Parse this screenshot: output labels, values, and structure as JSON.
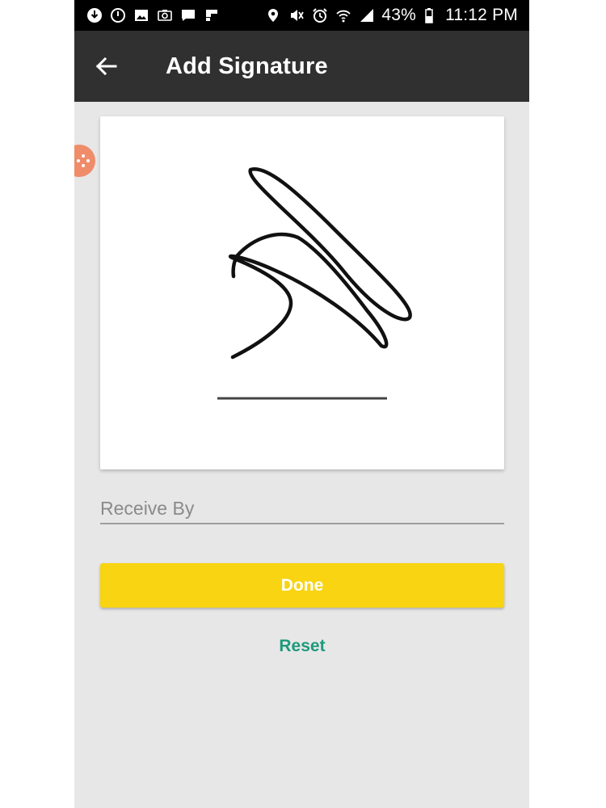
{
  "status_bar": {
    "left_icons": [
      "download-icon",
      "power-icon",
      "gallery-icon",
      "camera-icon",
      "chat-icon",
      "flipboard-icon"
    ],
    "right_icons": [
      "location-icon",
      "mute-icon",
      "alarm-icon",
      "wifi-icon",
      "signal-icon",
      "battery-icon"
    ],
    "battery": "43%",
    "time": "11:12 PM"
  },
  "app_bar": {
    "title": "Add Signature",
    "back_icon": "arrow-left-icon"
  },
  "signature_pad": {
    "stroke_color": "#111111",
    "baseline_color": "#444444"
  },
  "form": {
    "receive_by_placeholder": "Receive By",
    "receive_by_value": ""
  },
  "actions": {
    "done_label": "Done",
    "reset_label": "Reset"
  },
  "colors": {
    "app_bar": "#303030",
    "done_button": "#f8d412",
    "reset_text": "#1e9a7c",
    "floating_handle": "#ef8c6a"
  }
}
